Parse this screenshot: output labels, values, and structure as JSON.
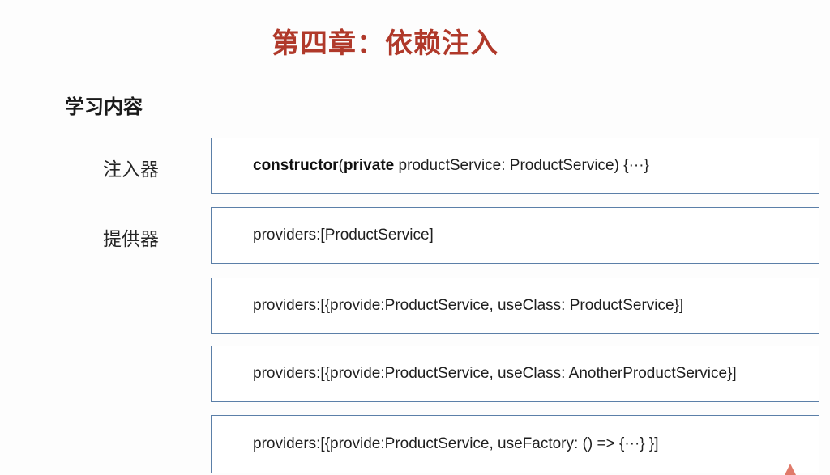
{
  "slide": {
    "title": "第四章：依赖注入",
    "section_heading": "学习内容",
    "watermark": "",
    "rows": [
      {
        "label": "注入器",
        "code": {
          "kw1": "constructor",
          "t1": "(",
          "kw2": "private",
          "t2": " productService: ProductService) {···}"
        }
      },
      {
        "label": "提供器",
        "code": {
          "text": "providers:[ProductService]"
        }
      },
      {
        "label": "",
        "code": {
          "text": "providers:[{provide:ProductService, useClass: ProductService}]"
        }
      },
      {
        "label": "",
        "code": {
          "text": "providers:[{provide:ProductService, useClass: AnotherProductService}]"
        }
      },
      {
        "label": "",
        "code": {
          "text": "providers:[{provide:ProductService, useFactory: () => {···} }]"
        }
      }
    ]
  }
}
